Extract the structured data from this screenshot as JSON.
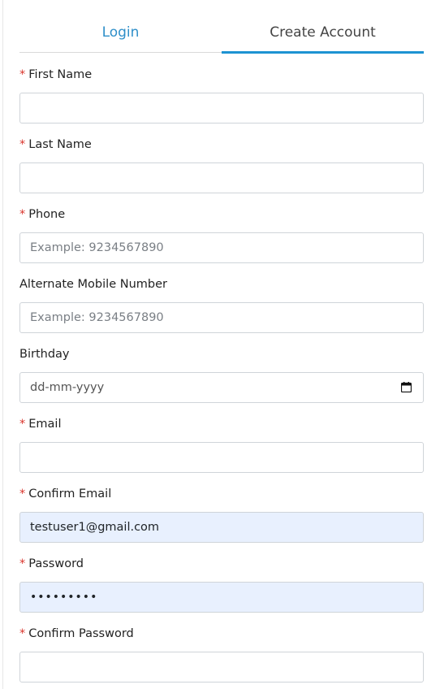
{
  "tabs": {
    "login": "Login",
    "create_account": "Create Account",
    "active": "Create Account"
  },
  "form": {
    "required_mark": "*",
    "first_name": {
      "label": "First Name",
      "value": ""
    },
    "last_name": {
      "label": "Last Name",
      "value": ""
    },
    "phone": {
      "label": "Phone",
      "placeholder": "Example: 9234567890",
      "value": ""
    },
    "alternate_mobile": {
      "label": "Alternate Mobile Number",
      "placeholder": "Example: 9234567890",
      "value": ""
    },
    "birthday": {
      "label": "Birthday",
      "placeholder": "dd-mm-yyyy",
      "icon": "calendar-icon"
    },
    "email": {
      "label": "Email",
      "value": ""
    },
    "confirm_email": {
      "label": "Confirm Email",
      "value": "testuser1@gmail.com"
    },
    "password": {
      "label": "Password",
      "masked_value": "•••••••••"
    },
    "confirm_password": {
      "label": "Confirm Password",
      "value": ""
    }
  },
  "colors": {
    "accent": "#1d93d2",
    "login_tab_text": "#2f8fc9",
    "required": "#d9342b",
    "autofill_bg": "#e8f0fe",
    "input_border": "#cfd4d9"
  }
}
